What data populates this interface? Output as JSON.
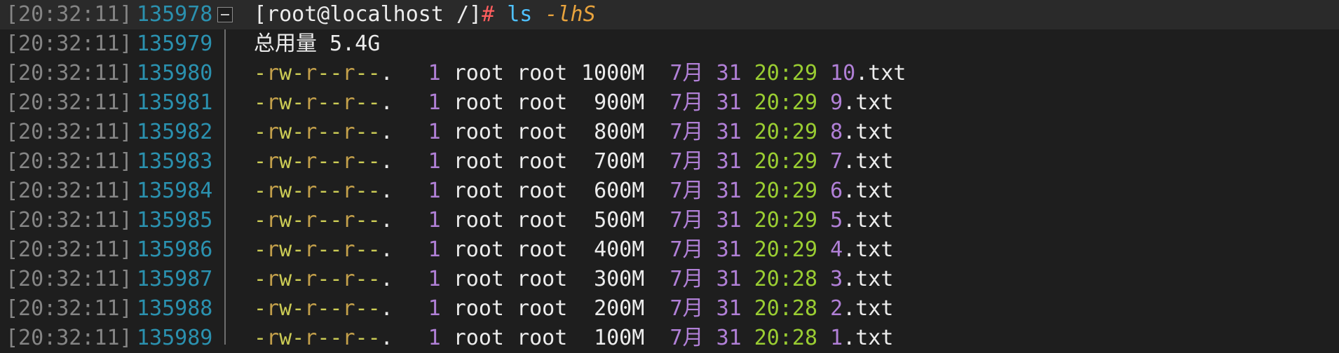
{
  "colors": {
    "background": "#1e1e1e",
    "timestamp": "#858585",
    "line_number": "#2b91af",
    "permissions": "#cccc55",
    "number": "#b180d7",
    "time": "#9acd32",
    "prompt_hash": "#ff5e5e",
    "command": "#4fc1ff",
    "flag": "#e8a33d"
  },
  "icons": {
    "fold_marker": "collapse-box-icon"
  },
  "prompt": {
    "timestamp": "[20:32:11]",
    "line_number": "135978",
    "user_host": "[root@localhost /]",
    "hash": "#",
    "command": "ls",
    "flag": "-lhS"
  },
  "total": {
    "timestamp": "[20:32:11]",
    "line_number": "135979",
    "text": "总用量 5.4G"
  },
  "files": [
    {
      "timestamp": "[20:32:11]",
      "line_number": "135980",
      "perms": "-rw-r--r--.",
      "links": "1",
      "owner": "root",
      "group": "root",
      "size": "1000M",
      "month": "7月",
      "day": "31",
      "time": "20:29",
      "name_num": "10",
      "name_ext": ".txt"
    },
    {
      "timestamp": "[20:32:11]",
      "line_number": "135981",
      "perms": "-rw-r--r--.",
      "links": "1",
      "owner": "root",
      "group": "root",
      "size": "900M",
      "month": "7月",
      "day": "31",
      "time": "20:29",
      "name_num": "9",
      "name_ext": ".txt"
    },
    {
      "timestamp": "[20:32:11]",
      "line_number": "135982",
      "perms": "-rw-r--r--.",
      "links": "1",
      "owner": "root",
      "group": "root",
      "size": "800M",
      "month": "7月",
      "day": "31",
      "time": "20:29",
      "name_num": "8",
      "name_ext": ".txt"
    },
    {
      "timestamp": "[20:32:11]",
      "line_number": "135983",
      "perms": "-rw-r--r--.",
      "links": "1",
      "owner": "root",
      "group": "root",
      "size": "700M",
      "month": "7月",
      "day": "31",
      "time": "20:29",
      "name_num": "7",
      "name_ext": ".txt"
    },
    {
      "timestamp": "[20:32:11]",
      "line_number": "135984",
      "perms": "-rw-r--r--.",
      "links": "1",
      "owner": "root",
      "group": "root",
      "size": "600M",
      "month": "7月",
      "day": "31",
      "time": "20:29",
      "name_num": "6",
      "name_ext": ".txt"
    },
    {
      "timestamp": "[20:32:11]",
      "line_number": "135985",
      "perms": "-rw-r--r--.",
      "links": "1",
      "owner": "root",
      "group": "root",
      "size": "500M",
      "month": "7月",
      "day": "31",
      "time": "20:29",
      "name_num": "5",
      "name_ext": ".txt"
    },
    {
      "timestamp": "[20:32:11]",
      "line_number": "135986",
      "perms": "-rw-r--r--.",
      "links": "1",
      "owner": "root",
      "group": "root",
      "size": "400M",
      "month": "7月",
      "day": "31",
      "time": "20:29",
      "name_num": "4",
      "name_ext": ".txt"
    },
    {
      "timestamp": "[20:32:11]",
      "line_number": "135987",
      "perms": "-rw-r--r--.",
      "links": "1",
      "owner": "root",
      "group": "root",
      "size": "300M",
      "month": "7月",
      "day": "31",
      "time": "20:28",
      "name_num": "3",
      "name_ext": ".txt"
    },
    {
      "timestamp": "[20:32:11]",
      "line_number": "135988",
      "perms": "-rw-r--r--.",
      "links": "1",
      "owner": "root",
      "group": "root",
      "size": "200M",
      "month": "7月",
      "day": "31",
      "time": "20:28",
      "name_num": "2",
      "name_ext": ".txt"
    },
    {
      "timestamp": "[20:32:11]",
      "line_number": "135989",
      "perms": "-rw-r--r--.",
      "links": "1",
      "owner": "root",
      "group": "root",
      "size": "100M",
      "month": "7月",
      "day": "31",
      "time": "20:28",
      "name_num": "1",
      "name_ext": ".txt"
    }
  ]
}
